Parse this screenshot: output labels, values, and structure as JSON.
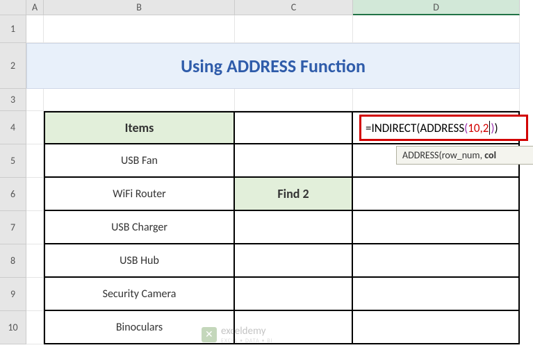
{
  "columns": [
    "A",
    "B",
    "C",
    "D"
  ],
  "rows": [
    "1",
    "2",
    "3",
    "4",
    "5",
    "6",
    "7",
    "8",
    "9",
    "10"
  ],
  "title": "Using ADDRESS Function",
  "header": {
    "items": "Items"
  },
  "data": {
    "b5": "USB Fan",
    "b6": "WiFi Router",
    "b7": "USB Charger",
    "b8": "USB Hub",
    "b9": "Security Camera",
    "b10": "Binoculars",
    "c6": "Find 2"
  },
  "formula": {
    "eq": "=",
    "fn1": "INDIRECT",
    "open1": "(",
    "fn2": "ADDRESS",
    "open2": "(",
    "args": "10,2",
    "close2": ")",
    "close1": ")"
  },
  "tooltip": {
    "prefix": "ADDRESS(row_num, ",
    "bold": "col"
  },
  "watermark": {
    "brand": "exceldemy",
    "sub": "EXCEL • DATA • BI"
  }
}
